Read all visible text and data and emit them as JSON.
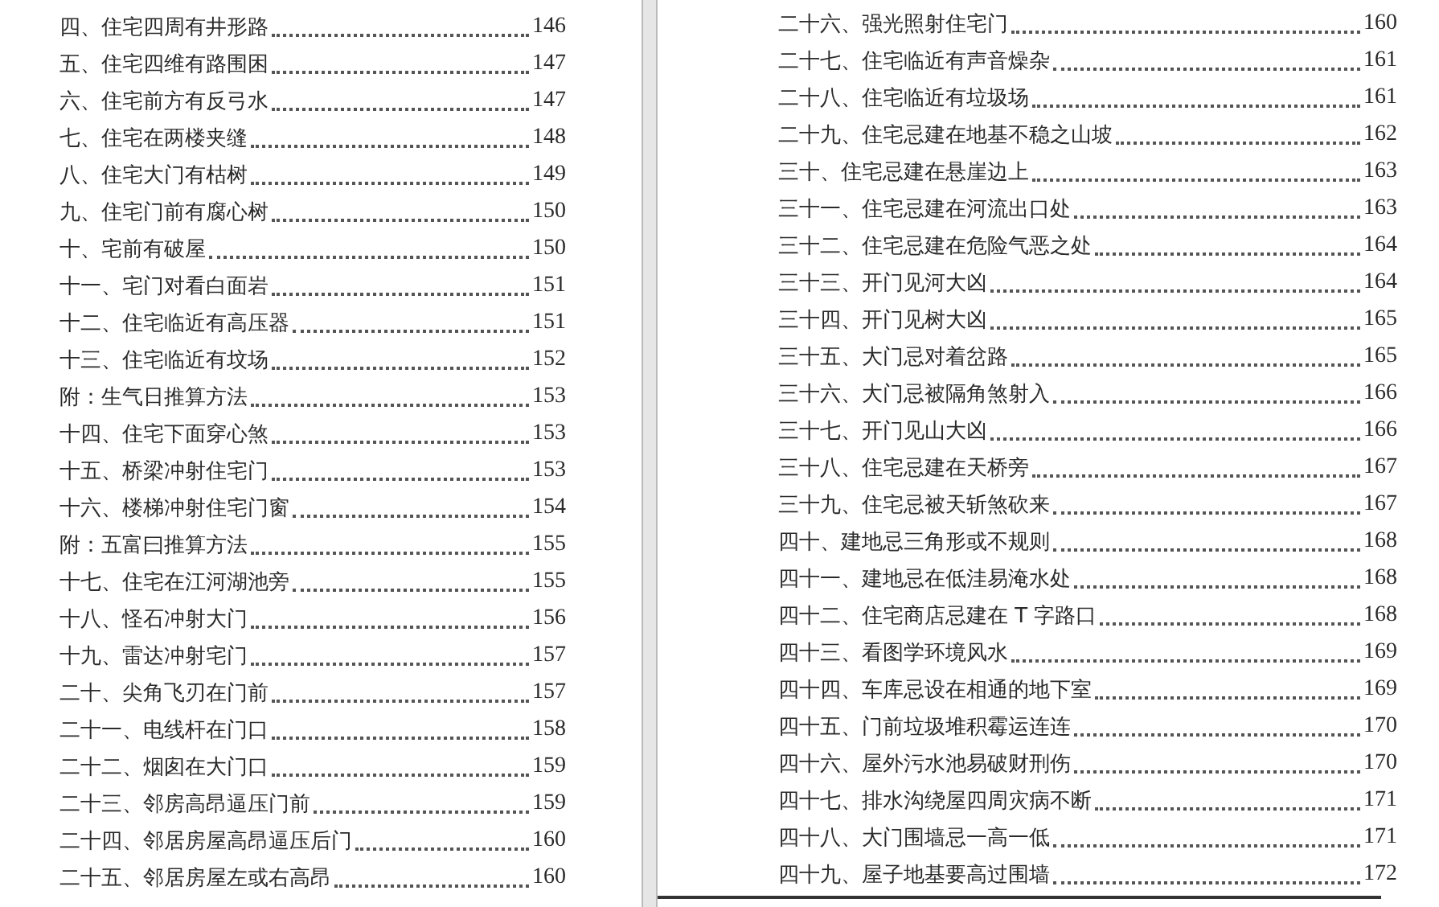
{
  "pages": [
    {
      "entries": [
        {
          "title": "四、住宅四周有井形路",
          "page": "146"
        },
        {
          "title": "五、住宅四维有路围困",
          "page": "147"
        },
        {
          "title": "六、住宅前方有反弓水",
          "page": "147"
        },
        {
          "title": "七、住宅在两楼夹缝",
          "page": "148"
        },
        {
          "title": "八、住宅大门有枯树",
          "page": "149"
        },
        {
          "title": "九、住宅门前有腐心树",
          "page": "150"
        },
        {
          "title": "十、宅前有破屋",
          "page": "150"
        },
        {
          "title": "十一、宅门对看白面岩",
          "page": "151"
        },
        {
          "title": "十二、住宅临近有高压器",
          "page": "151"
        },
        {
          "title": "十三、住宅临近有坟场",
          "page": "152"
        },
        {
          "title": "附：生气日推算方法",
          "page": "153"
        },
        {
          "title": "十四、住宅下面穿心煞",
          "page": "153"
        },
        {
          "title": "十五、桥梁冲射住宅门",
          "page": "153"
        },
        {
          "title": "十六、楼梯冲射住宅门窗",
          "page": "154"
        },
        {
          "title": "附：五富曰推算方法",
          "page": "155"
        },
        {
          "title": "十七、住宅在江河湖池旁",
          "page": "155"
        },
        {
          "title": "十八、怪石冲射大门",
          "page": "156"
        },
        {
          "title": "十九、雷达冲射宅门",
          "page": "157"
        },
        {
          "title": "二十、尖角飞刃在门前",
          "page": "157"
        },
        {
          "title": "二十一、电线杆在门口",
          "page": "158"
        },
        {
          "title": "二十二、烟囱在大门口",
          "page": "159"
        },
        {
          "title": "二十三、邻房高昂逼压门前",
          "page": "159"
        },
        {
          "title": "二十四、邻居房屋高昂逼压后门",
          "page": "160"
        },
        {
          "title": "二十五、邻居房屋左或右高昂",
          "page": "160"
        }
      ]
    },
    {
      "entries": [
        {
          "title": "二十六、强光照射住宅门",
          "page": "160"
        },
        {
          "title": "二十七、住宅临近有声音燥杂",
          "page": "161"
        },
        {
          "title": "二十八、住宅临近有垃圾场",
          "page": "161"
        },
        {
          "title": "二十九、住宅忌建在地基不稳之山坡",
          "page": "162"
        },
        {
          "title": "三十、住宅忌建在悬崖边上",
          "page": "163"
        },
        {
          "title": "三十一、住宅忌建在河流出口处",
          "page": "163"
        },
        {
          "title": "三十二、住宅忌建在危险气恶之处",
          "page": "164"
        },
        {
          "title": "三十三、开门见河大凶",
          "page": "164"
        },
        {
          "title": "三十四、开门见树大凶",
          "page": "165"
        },
        {
          "title": "三十五、大门忌对着岔路",
          "page": "165"
        },
        {
          "title": "三十六、大门忌被隔角煞射入",
          "page": "166"
        },
        {
          "title": "三十七、开门见山大凶",
          "page": "166"
        },
        {
          "title": "三十八、住宅忌建在天桥旁",
          "page": "167"
        },
        {
          "title": "三十九、住宅忌被天斩煞砍来",
          "page": "167"
        },
        {
          "title": "四十、建地忌三角形或不规则",
          "page": "168"
        },
        {
          "title": "四十一、建地忌在低洼易淹水处",
          "page": "168"
        },
        {
          "title": "四十二、住宅商店忌建在 T 字路口",
          "page": "168"
        },
        {
          "title": "四十三、看图学环境风水",
          "page": "169"
        },
        {
          "title": "四十四、车库忌设在相通的地下室",
          "page": "169"
        },
        {
          "title": "四十五、门前垃圾堆积霉运连连",
          "page": "170"
        },
        {
          "title": "四十六、屋外污水池易破财刑伤",
          "page": "170"
        },
        {
          "title": "四十七、排水沟绕屋四周灾病不断",
          "page": "171"
        },
        {
          "title": "四十八、大门围墙忌一高一低",
          "page": "171"
        },
        {
          "title": "四十九、屋子地基要高过围墙",
          "page": "172"
        }
      ]
    }
  ]
}
